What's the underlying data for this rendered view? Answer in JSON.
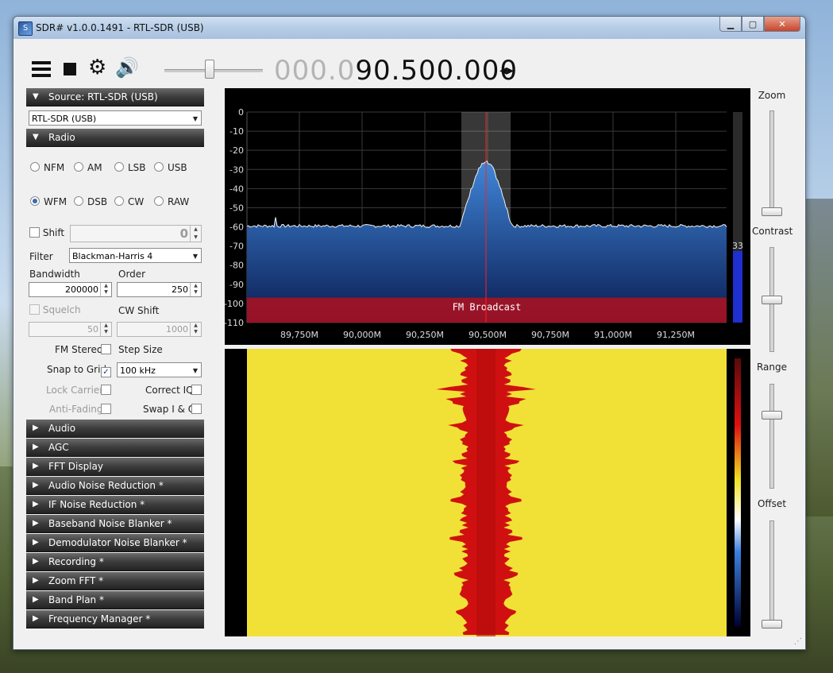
{
  "window": {
    "title": "SDR# v1.0.0.1491 - RTL-SDR (USB)",
    "min_glyph": "▁",
    "max_glyph": "▢",
    "close_glyph": "✕"
  },
  "toolbar": {
    "frequency_dim": "000.0",
    "frequency_bright": "90.500.000",
    "volume_fraction": 0.45
  },
  "source": {
    "header": "Source: RTL-SDR (USB)",
    "device": "RTL-SDR (USB)"
  },
  "radio": {
    "header": "Radio",
    "modes": [
      "NFM",
      "AM",
      "LSB",
      "USB",
      "WFM",
      "DSB",
      "CW",
      "RAW"
    ],
    "selected_mode": "WFM",
    "shift_label": "Shift",
    "shift_value": "0",
    "filter_label": "Filter",
    "filter_value": "Blackman-Harris 4",
    "bandwidth_label": "Bandwidth",
    "bandwidth_value": "200000",
    "order_label": "Order",
    "order_value": "250",
    "squelch_label": "Squelch",
    "squelch_value": "50",
    "cwshift_label": "CW Shift",
    "cwshift_value": "1000",
    "fmstereo_label": "FM Stereo",
    "stepsize_label": "Step Size",
    "snap_label": "Snap to Grid",
    "step_value": "100 kHz",
    "lockcarrier_label": "Lock Carrier",
    "correctiq_label": "Correct IQ",
    "antifading_label": "Anti-Fading",
    "swapiq_label": "Swap I & Q"
  },
  "plugins": [
    "Audio",
    "AGC",
    "FFT Display",
    "Audio Noise Reduction *",
    "IF Noise Reduction *",
    "Baseband Noise Blanker *",
    "Demodulator Noise Blanker *",
    "Recording *",
    "Zoom FFT *",
    "Band Plan *",
    "Frequency Manager *"
  ],
  "spectrum": {
    "y_ticks": [
      "0",
      "-10",
      "-20",
      "-30",
      "-40",
      "-50",
      "-60",
      "-70",
      "-80",
      "-90",
      "-100",
      "-110"
    ],
    "x_ticks": [
      "89,750M",
      "90,000M",
      "90,250M",
      "90,500M",
      "90,750M",
      "91,000M",
      "91,250M"
    ],
    "band_label": "FM Broadcast",
    "level_value": "33"
  },
  "right": {
    "zoom_label": "Zoom",
    "contrast_label": "Contrast",
    "range_label": "Range",
    "offset_label": "Offset"
  }
}
